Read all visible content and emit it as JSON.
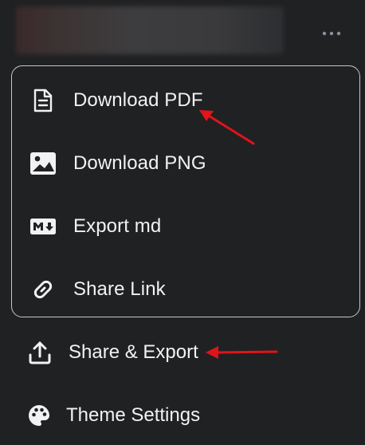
{
  "topbar": {
    "title": "",
    "more_icon": "more-horizontal-icon"
  },
  "export_menu": {
    "items": [
      {
        "label": "Download PDF",
        "icon": "document-icon"
      },
      {
        "label": "Download PNG",
        "icon": "image-icon"
      },
      {
        "label": "Export md",
        "icon": "markdown-icon"
      },
      {
        "label": "Share Link",
        "icon": "link-icon"
      }
    ]
  },
  "main_menu": {
    "share_export": {
      "label": "Share & Export",
      "icon": "upload-icon"
    },
    "theme_settings": {
      "label": "Theme Settings",
      "icon": "palette-icon"
    }
  },
  "colors": {
    "background": "#202123",
    "text": "#f2f2f4",
    "border": "#c7c7cc",
    "annotation": "#e0141a"
  }
}
